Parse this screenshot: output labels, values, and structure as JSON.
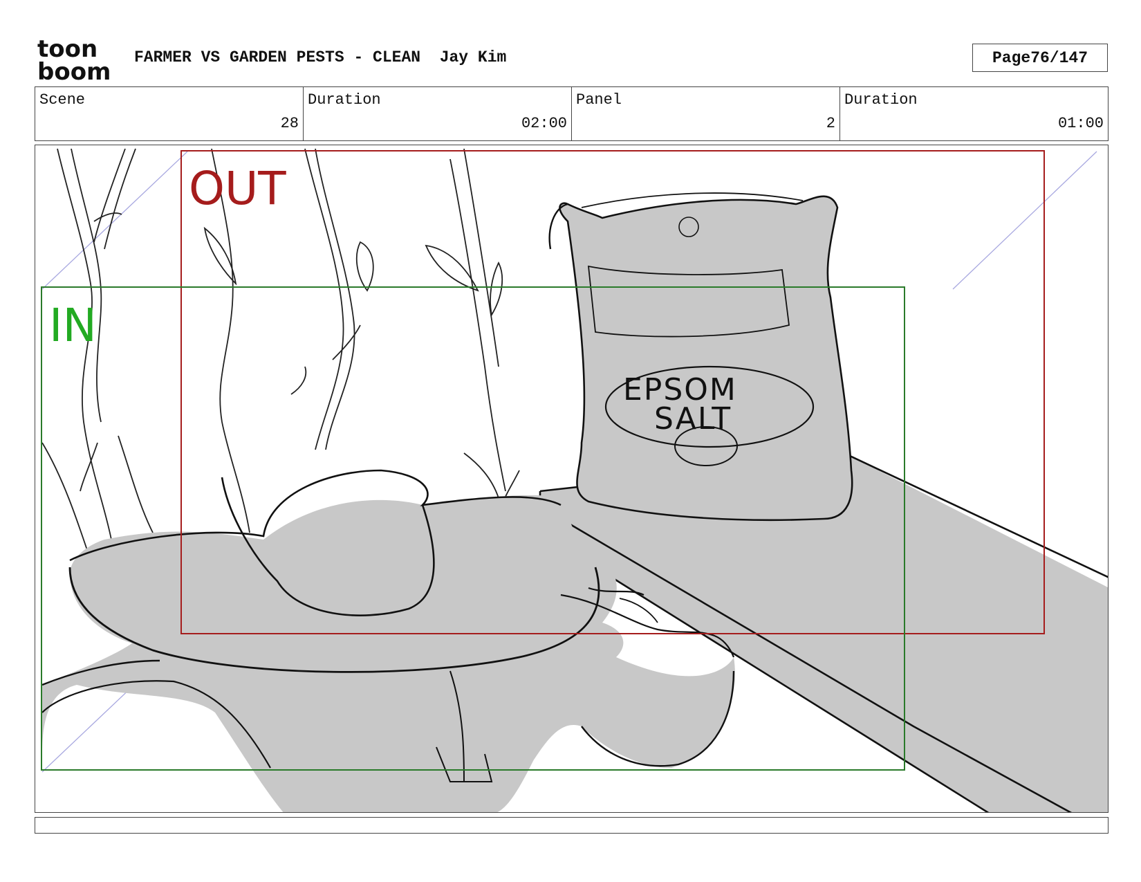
{
  "header": {
    "logo_top": "toon",
    "logo_bottom": "boom",
    "project_title": "FARMER VS GARDEN PESTS - CLEAN",
    "author": "Jay Kim",
    "page_label": "Page",
    "page_value": "76/147"
  },
  "info": {
    "scene_label": "Scene",
    "scene_value": "28",
    "scene_duration_label": "Duration",
    "scene_duration_value": "02:00",
    "panel_label": "Panel",
    "panel_value": "2",
    "panel_duration_label": "Duration",
    "panel_duration_value": "01:00"
  },
  "frame": {
    "out_label": "OUT",
    "in_label": "IN",
    "out_color": "#a51c1c",
    "in_color": "#2a7a2a",
    "bag_text_line1": "EPSOM",
    "bag_text_line2": "SALT",
    "sketch_fill": "#c8c8c8"
  },
  "notes": {
    "text": ""
  }
}
